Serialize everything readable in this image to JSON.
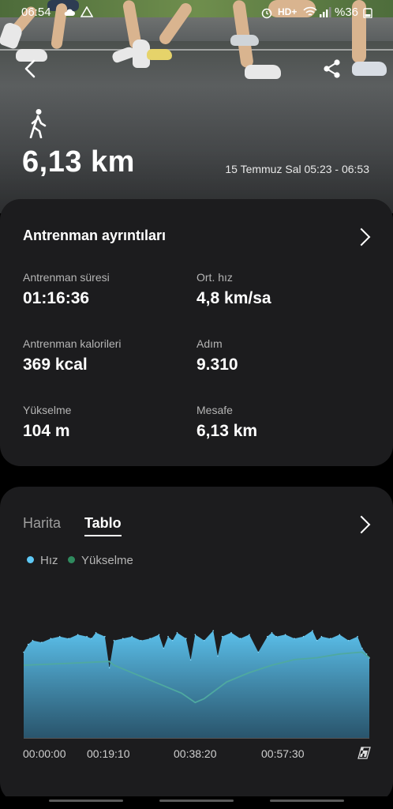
{
  "status_bar": {
    "time": "06:54",
    "battery": "%36",
    "network": "HD+",
    "icons": [
      "cloud-icon",
      "warning-icon",
      "alarm-icon",
      "wifi-icon",
      "signal-icon",
      "battery-icon"
    ]
  },
  "header": {
    "activity_icon": "walking-icon",
    "distance": "6,13 km",
    "date_range": "15 Temmuz Sal 05:23 - 06:53"
  },
  "details": {
    "title": "Antrenman ayrıntıları",
    "stats": [
      {
        "label": "Antrenman süresi",
        "value": "01:16:36"
      },
      {
        "label": "Ort. hız",
        "value": "4,8 km/sa"
      },
      {
        "label": "Antrenman kalorileri",
        "value": "369 kcal"
      },
      {
        "label": "Adım",
        "value": "9.310"
      },
      {
        "label": "Yükselme",
        "value": "104 m"
      },
      {
        "label": "Mesafe",
        "value": "6,13 km"
      }
    ]
  },
  "chart_card": {
    "tabs": [
      {
        "label": "Harita",
        "active": false
      },
      {
        "label": "Tablo",
        "active": true
      }
    ],
    "legend": [
      {
        "label": "Hız",
        "color": "#5ec8f5"
      },
      {
        "label": "Yükselme",
        "color": "#2f8a5e"
      }
    ]
  },
  "chart_data": {
    "type": "area",
    "x_ticks": [
      "00:00:00",
      "00:19:10",
      "00:38:20",
      "00:57:30"
    ],
    "x_range_minutes": [
      0,
      76.6
    ],
    "series": [
      {
        "name": "Hız",
        "color": "#5ec8f5",
        "x": [
          0,
          1,
          2,
          4,
          6,
          8,
          10,
          12,
          14,
          15,
          16,
          18,
          19,
          20,
          22,
          24,
          26,
          28,
          30,
          31,
          32,
          33,
          34,
          36,
          37,
          38,
          40,
          42,
          43,
          44,
          46,
          48,
          50,
          52,
          54,
          55,
          56,
          58,
          60,
          62,
          64,
          65,
          66,
          68,
          70,
          72,
          74,
          75,
          76,
          76.6
        ],
        "values": [
          4.4,
          4.8,
          5.0,
          4.9,
          5.1,
          5.2,
          5.1,
          5.3,
          5.2,
          5.1,
          5.4,
          5.2,
          3.6,
          5.0,
          5.1,
          5.2,
          5.0,
          5.1,
          5.3,
          4.6,
          5.2,
          5.0,
          5.4,
          5.1,
          4.0,
          5.3,
          5.0,
          5.5,
          4.2,
          5.2,
          5.4,
          5.1,
          5.3,
          4.4,
          5.2,
          5.4,
          5.2,
          5.3,
          5.1,
          5.2,
          5.5,
          5.0,
          5.2,
          5.1,
          5.3,
          5.0,
          5.2,
          4.6,
          4.3,
          4.1
        ]
      },
      {
        "name": "Yükselme",
        "color": "#2f8a5e",
        "x": [
          0,
          10,
          19,
          20,
          25,
          30,
          35,
          38,
          40,
          45,
          50,
          55,
          60,
          65,
          70,
          75,
          76.6
        ],
        "values": [
          78,
          80,
          82,
          78,
          68,
          58,
          48,
          38,
          42,
          60,
          70,
          78,
          84,
          86,
          90,
          92,
          86
        ]
      }
    ],
    "grid": false
  }
}
